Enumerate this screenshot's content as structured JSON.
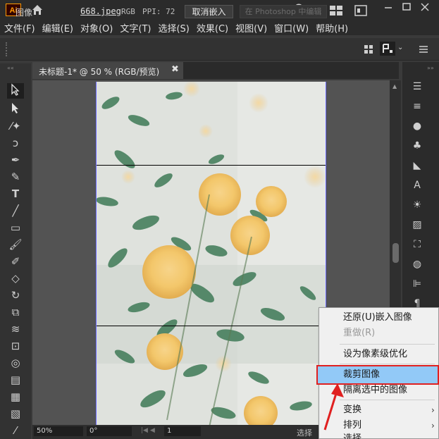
{
  "titlebar": {
    "app_logo": "Ai",
    "icons": [
      "home-icon",
      "search-icon",
      "workspace-icon",
      "panel-icon",
      "minimize-icon",
      "maximize-icon",
      "close-icon"
    ]
  },
  "menubar": {
    "items": [
      "文件(F)",
      "编辑(E)",
      "对象(O)",
      "文字(T)",
      "选择(S)",
      "效果(C)",
      "视图(V)",
      "窗口(W)",
      "帮助(H)"
    ]
  },
  "controlbar": {
    "type_label": "图像",
    "file_name": "668.jpeg",
    "color_mode": "RGB",
    "ppi": "PPI: 72",
    "unembed_button": "取消嵌入",
    "photoshop_button": "在 Photoshop 中编辑"
  },
  "document": {
    "tab_label": "未标题-1* @ 50 % (RGB/预览)",
    "tab_close": "✖"
  },
  "statusbar": {
    "zoom": "50%",
    "rotation": "0°",
    "page": "1",
    "mode": "选择"
  },
  "context_menu": {
    "items": [
      {
        "label": "还原(U)嵌入图像",
        "disabled": false
      },
      {
        "label": "重做(R)",
        "disabled": true
      },
      {
        "label": "设为像素级优化",
        "disabled": false
      },
      {
        "label": "裁剪图像",
        "disabled": false,
        "highlighted": true
      },
      {
        "label": "隔离选中的图像",
        "disabled": false
      },
      {
        "label": "变换",
        "disabled": false,
        "submenu": true
      },
      {
        "label": "排列",
        "disabled": false,
        "submenu": true
      },
      {
        "label": "选择",
        "disabled": false
      }
    ]
  },
  "colors": {
    "highlight": "#92c9f7",
    "annotation_red": "#e02020",
    "artboard_border": "#6a6aff"
  }
}
